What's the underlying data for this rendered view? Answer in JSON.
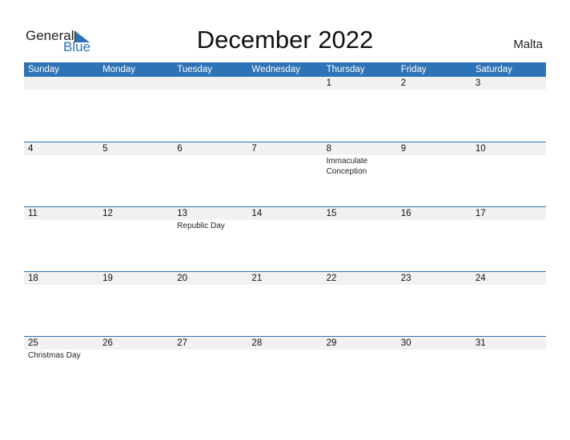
{
  "logo": {
    "general": "General",
    "blue": "Blue"
  },
  "title": "December 2022",
  "country": "Malta",
  "weekdays": [
    "Sunday",
    "Monday",
    "Tuesday",
    "Wednesday",
    "Thursday",
    "Friday",
    "Saturday"
  ],
  "weeks": [
    {
      "days": [
        "",
        "",
        "",
        "",
        "1",
        "2",
        "3"
      ],
      "events": [
        "",
        "",
        "",
        "",
        "",
        "",
        ""
      ]
    },
    {
      "days": [
        "4",
        "5",
        "6",
        "7",
        "8",
        "9",
        "10"
      ],
      "events": [
        "",
        "",
        "",
        "",
        "Immaculate Conception",
        "",
        ""
      ]
    },
    {
      "days": [
        "11",
        "12",
        "13",
        "14",
        "15",
        "16",
        "17"
      ],
      "events": [
        "",
        "",
        "Republic Day",
        "",
        "",
        "",
        ""
      ]
    },
    {
      "days": [
        "18",
        "19",
        "20",
        "21",
        "22",
        "23",
        "24"
      ],
      "events": [
        "",
        "",
        "",
        "",
        "",
        "",
        ""
      ]
    },
    {
      "days": [
        "25",
        "26",
        "27",
        "28",
        "29",
        "30",
        "31"
      ],
      "events": [
        "Christmas Day",
        "",
        "",
        "",
        "",
        "",
        ""
      ]
    }
  ],
  "colors": {
    "accent": "#2e73b5",
    "strip": "#f1f1f1"
  }
}
